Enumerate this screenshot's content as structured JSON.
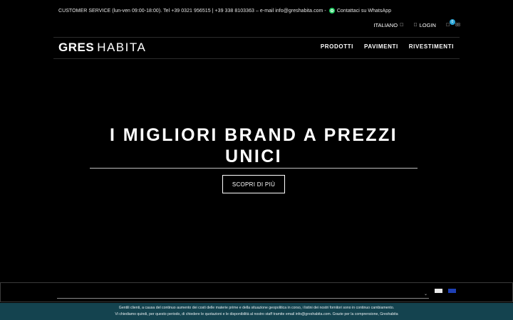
{
  "topbar": {
    "service_text": "CUSTOMER SERVICE (lun-ven 09:00-18:00). Tel +39 0321 956515 | +39 338 8103363 – e-mail info@greshabita.com -",
    "whatsapp_label": "Contattaci su WhatsApp"
  },
  "utility": {
    "language": "ITALIANO",
    "language_icon": "",
    "login_icon": "",
    "login": "LOGIN",
    "cart_icon": "",
    "cart_count": "0",
    "search_icon": ""
  },
  "header": {
    "logo_bold": "GRES",
    "logo_thin": "HABITA",
    "nav": [
      "PRODOTTI",
      "PAVIMENTI",
      "RIVESTIMENTI"
    ]
  },
  "hero": {
    "title": "I MIGLIORI BRAND A PREZZI UNICI",
    "button": "SCOPRI DI PIÙ"
  },
  "panel": {
    "caret": "⌄"
  },
  "notice": {
    "line1": "Gentili clienti, a causa del continuo aumento dei costi delle materie prime e della situazione geopolitica in corso, i listini dei nostri fornitori sono in continuo cambiamento.",
    "line2": "Vi chiediamo quindi, per questo periodo, di chiedere le quotazioni e le disponibilità al nostro staff tramite email info@greshabita.com. Grazie per la comprensione, Greshabita"
  },
  "colors": {
    "background": "#000000",
    "notice_bar": "#14434f",
    "cart_badge": "#2aa6d9",
    "whatsapp": "#25d366"
  }
}
